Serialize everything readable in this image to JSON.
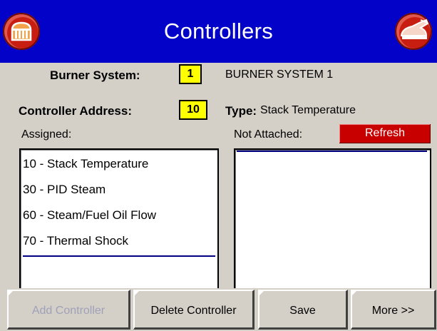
{
  "header": {
    "title": "Controllers",
    "left_icon": "home-panel-icon",
    "right_icon": "exit-icon",
    "bar_color": "#0202c8",
    "button_color": "#c81e12"
  },
  "form": {
    "burner_system_label": "Burner System:",
    "burner_system_value": "1",
    "burner_system_name": "BURNER SYSTEM 1",
    "controller_address_label": "Controller Address:",
    "controller_address_value": "10",
    "type_label": "Type:",
    "type_value": "Stack Temperature",
    "field_color": "#ffff00"
  },
  "assigned": {
    "label": "Assigned:",
    "items": [
      "10 - Stack Temperature",
      "30 - PID Steam",
      "60 - Steam/Fuel Oil Flow",
      "70 - Thermal Shock"
    ]
  },
  "not_attached": {
    "label": "Not Attached:",
    "refresh_label": "Refresh",
    "refresh_color": "#c80000",
    "items": []
  },
  "buttons": {
    "add_controller": "Add Controller",
    "delete_controller": "Delete Controller",
    "save": "Save",
    "more": "More >>"
  }
}
